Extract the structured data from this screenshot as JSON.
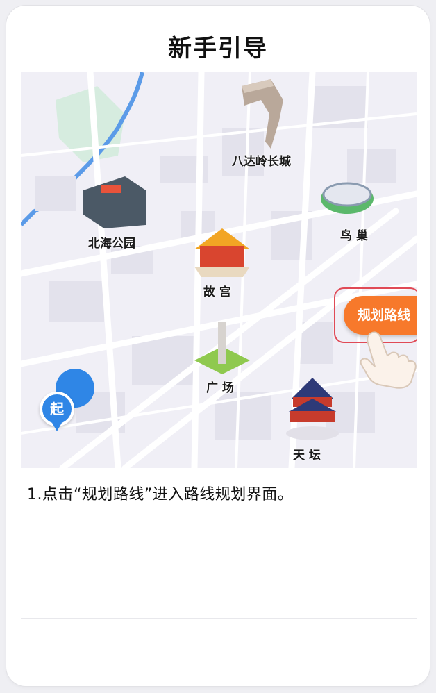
{
  "header": {
    "title": "新手引导"
  },
  "map": {
    "landmarks": {
      "great_wall": "八达岭长城",
      "beihai": "北海公园",
      "birds_nest": "鸟 巢",
      "forbidden_city": "故 宫",
      "square": "广 场",
      "temple_heaven": "天 坛"
    },
    "start_marker": "起",
    "plan_button_label": "规划路线"
  },
  "guide": {
    "step_text": "1.点击“规划路线”进入路线规划界面。"
  },
  "colors": {
    "accent": "#f7792b",
    "highlight_border": "#e04a56",
    "start_pin": "#2f86e6"
  },
  "icons": [
    "pointing-hand-icon",
    "start-pin-icon"
  ]
}
